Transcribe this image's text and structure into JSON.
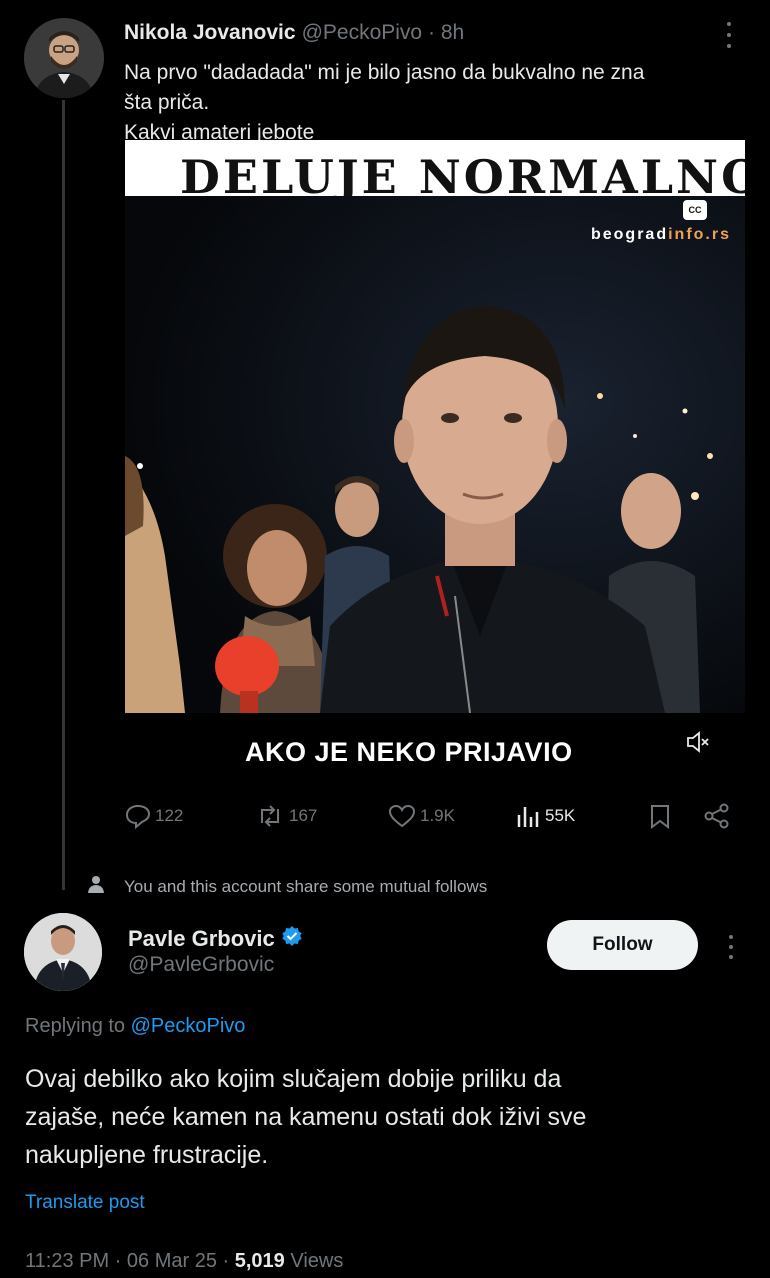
{
  "tweet1": {
    "name": "Nikola Jovanovic",
    "handle": "@PeckoPivo",
    "separator": "·",
    "time": "8h",
    "text_lines": [
      "Na prvo \"dadadada\" mi je bilo jasno da bukvalno ne zna",
      "šta priča.",
      "Kakvi amateri jebote"
    ],
    "video": {
      "top_caption": "DELUJE NORMALNO!",
      "cc_label": "CC",
      "watermark_main": "beograd",
      "watermark_accent": "info.rs",
      "subtitle": "AKO JE NEKO PRIJAVIO"
    },
    "actions": {
      "replies": "122",
      "reposts": "167",
      "likes": "1.9K",
      "views": "55K"
    }
  },
  "social_context": "You and this account share some mutual follows",
  "tweet2": {
    "name": "Pavle Grbovic",
    "handle": "@PavleGrbovic",
    "follow_label": "Follow",
    "replying_prefix": "Replying to",
    "replying_to": "@PeckoPivo",
    "text_lines": [
      "Ovaj debilko ako kojim slučajem dobije priliku da",
      "zajaše, neće kamen na kamenu ostati dok iživi sve",
      "nakupljene frustracije."
    ],
    "translate_label": "Translate post",
    "time": "11:23 PM",
    "date": "06 Mar 25",
    "views_count": "5,019",
    "views_label": "Views"
  },
  "colors": {
    "background": "#000000",
    "text": "#e7e9ea",
    "muted": "#71767b",
    "link": "#1d9bf0",
    "verified": "#1d9bf0"
  }
}
